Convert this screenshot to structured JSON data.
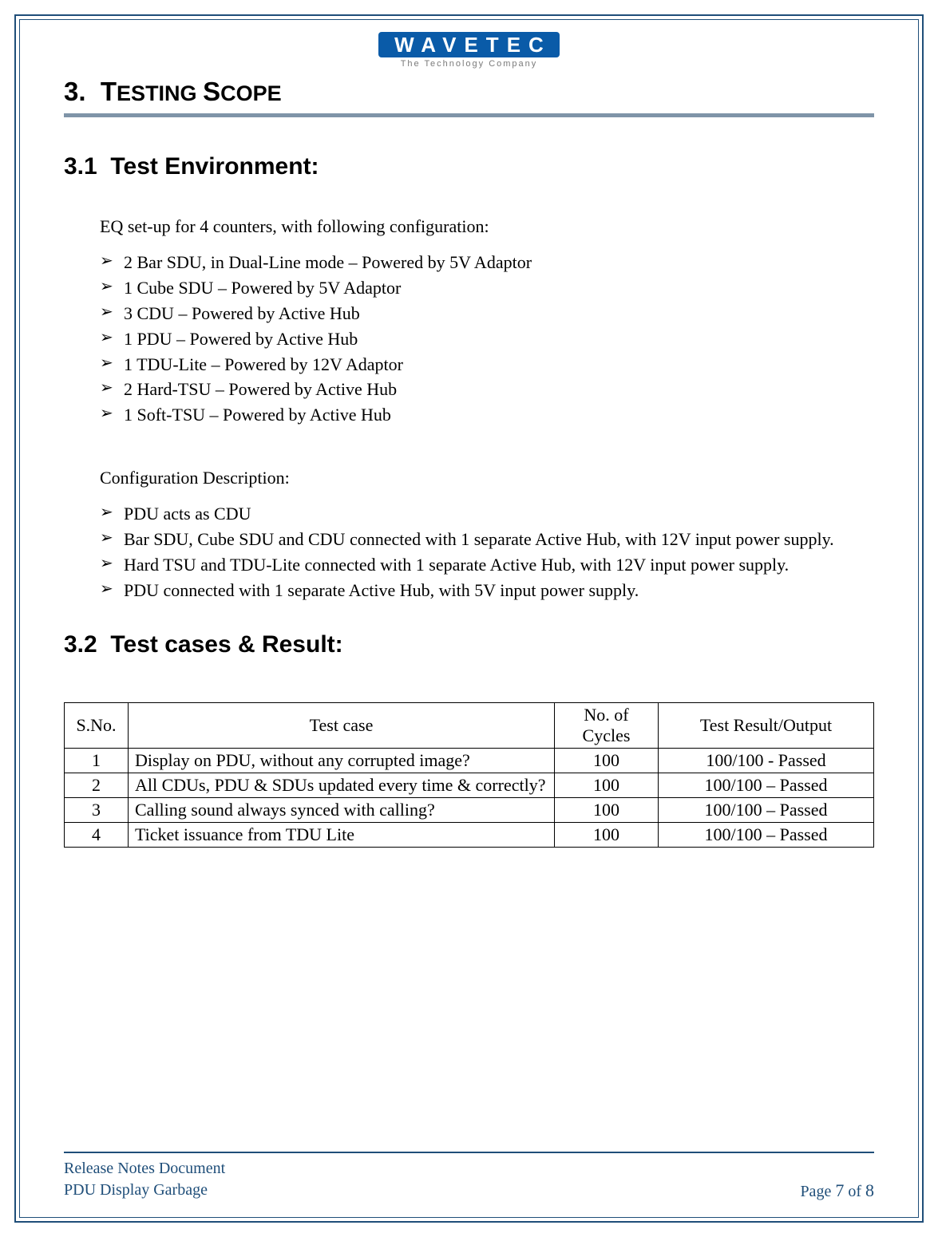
{
  "logo": {
    "name": "WAVETEC",
    "tagline": "The Technology Company"
  },
  "section": {
    "number": "3.",
    "title_parts": [
      "T",
      "ESTING ",
      "S",
      "COPE"
    ]
  },
  "sub1": {
    "number": "3.1",
    "title": "Test Environment:"
  },
  "env_intro": "EQ set-up for 4 counters, with following configuration:",
  "env_items": [
    "2 Bar SDU, in Dual-Line mode – Powered by 5V Adaptor",
    "1 Cube SDU – Powered by 5V Adaptor",
    "3 CDU – Powered by Active Hub",
    "1 PDU – Powered by Active Hub",
    "1 TDU-Lite – Powered by 12V Adaptor",
    "2 Hard-TSU – Powered by Active Hub",
    "1 Soft-TSU – Powered by Active Hub"
  ],
  "config_intro": "Configuration Description:",
  "config_items": [
    "PDU acts as CDU",
    "Bar SDU, Cube SDU and CDU connected with 1 separate Active Hub, with 12V input power supply.",
    "Hard TSU and TDU-Lite connected with 1 separate Active Hub, with 12V input power supply.",
    "PDU connected with 1 separate Active Hub, with 5V input power supply."
  ],
  "sub2": {
    "number": "3.2",
    "title": "Test cases & Result:"
  },
  "table": {
    "headers": [
      "S.No.",
      "Test case",
      "No. of Cycles",
      "Test Result/Output"
    ],
    "rows": [
      {
        "sno": "1",
        "case": "Display on PDU, without any corrupted image?",
        "cycles": "100",
        "result": "100/100 - Passed"
      },
      {
        "sno": "2",
        "case": "All CDUs, PDU & SDUs updated every time & correctly?",
        "cycles": "100",
        "result": "100/100 – Passed"
      },
      {
        "sno": "3",
        "case": "Calling sound always synced with calling?",
        "cycles": "100",
        "result": "100/100 – Passed"
      },
      {
        "sno": "4",
        "case": "Ticket issuance from TDU Lite",
        "cycles": "100",
        "result": "100/100 – Passed"
      }
    ]
  },
  "footer": {
    "line1": "Release Notes Document",
    "line2": "PDU Display Garbage",
    "page_label_pre": "Page ",
    "page_num": "7",
    "page_of": " of ",
    "page_total": "8"
  }
}
